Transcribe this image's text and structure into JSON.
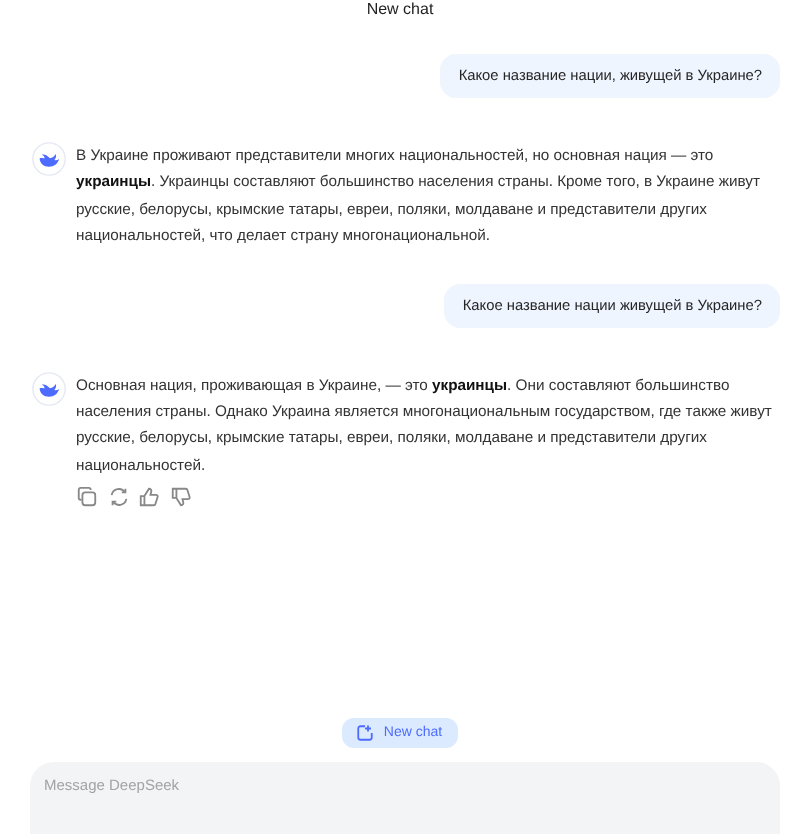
{
  "header": {
    "title": "New chat"
  },
  "messages": [
    {
      "kind": "user",
      "text": "Какое название нации, живущей в Украине?"
    },
    {
      "kind": "assistant",
      "text": "В Украине проживают представители многих национальностей, но основная нация — это **украинцы**. Украинцы составляют большинство населения страны. Кроме того, в Украине живут русские, белорусы, крымские татары, евреи, поляки, молдаване и представители других национальностей, что делает страну многонациональной.",
      "actions": false
    },
    {
      "kind": "user",
      "text": "Какое название нации живущей в Украине?"
    },
    {
      "kind": "assistant",
      "text": "Основная нация, проживающая в Украине, — это **украинцы**. Они составляют большинство населения страны. Однако Украина является многонациональным государством, где также живут русские, белорусы, крымские татары, евреи, поляки, молдаване и представители других национальностей.",
      "actions": true
    }
  ],
  "new_chat_button": {
    "label": "New chat"
  },
  "composer": {
    "placeholder": "Message DeepSeek"
  }
}
